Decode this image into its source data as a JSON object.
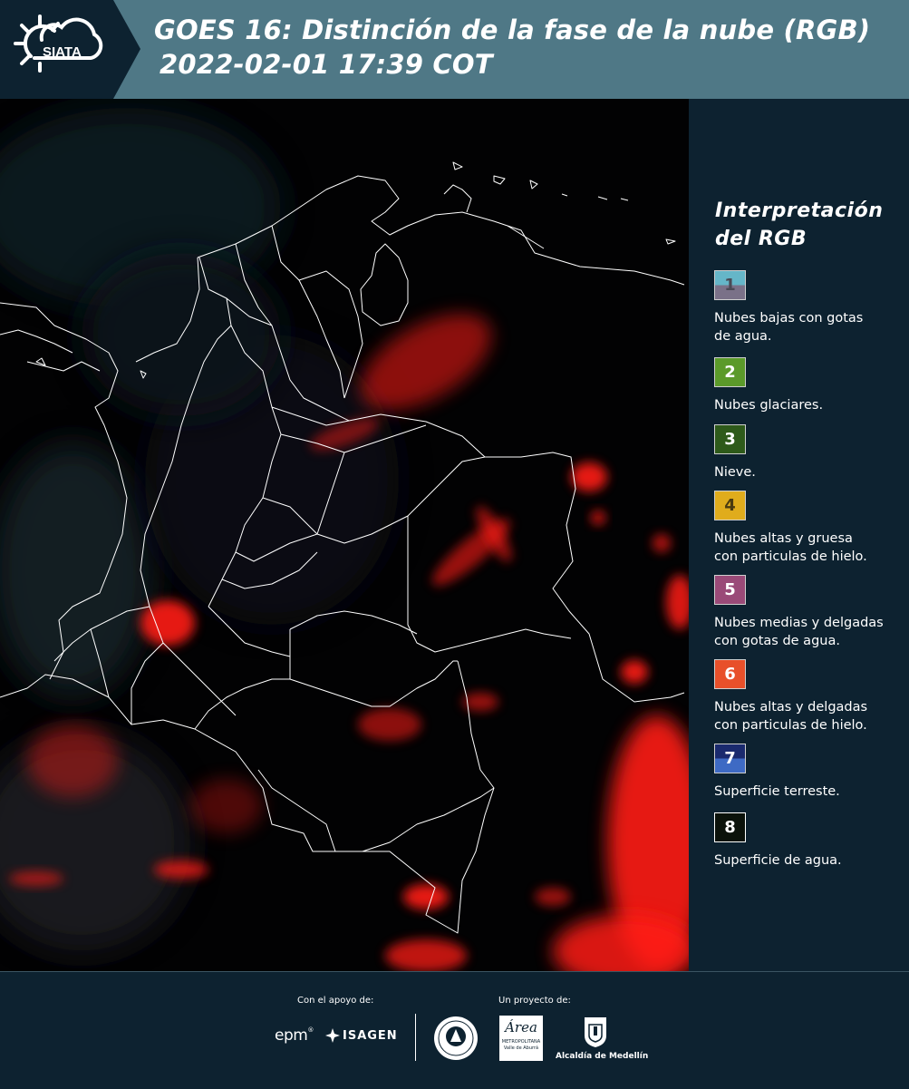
{
  "header": {
    "logo_text": "SIATA",
    "title_line1": "GOES 16: Distinción de la fase de la nube (RGB)",
    "title_line2": "2022-02-01 17:39 COT"
  },
  "legend": {
    "title_line1": "Interpretación",
    "title_line2": "del RGB",
    "items": [
      {
        "num": "1",
        "label_line1": "Nubes bajas con gotas",
        "label_line2": "de agua.",
        "color_top": "#65b6c8",
        "color_bottom": "#7a7188",
        "num_color": "#4a4a55"
      },
      {
        "num": "2",
        "label_line1": "Nubes glaciares.",
        "label_line2": "",
        "color_top": "#5b9a2a",
        "color_bottom": "#5b9a2a",
        "num_color": "#ffffff"
      },
      {
        "num": "3",
        "label_line1": "Nieve.",
        "label_line2": "",
        "color_top": "#2e5a1a",
        "color_bottom": "#2e5a1a",
        "num_color": "#ffffff"
      },
      {
        "num": "4",
        "label_line1": "Nubes altas y gruesa",
        "label_line2": "con particulas de hielo.",
        "color_top": "#e0ac1c",
        "color_bottom": "#e0ac1c",
        "num_color": "#4a3a10"
      },
      {
        "num": "5",
        "label_line1": "Nubes medias y delgadas",
        "label_line2": "con gotas de agua.",
        "color_top": "#9a4a78",
        "color_bottom": "#9a4a78",
        "num_color": "#ffffff"
      },
      {
        "num": "6",
        "label_line1": "Nubes altas y delgadas",
        "label_line2": "con particulas de hielo.",
        "color_top": "#e8502a",
        "color_bottom": "#e8502a",
        "num_color": "#ffffff"
      },
      {
        "num": "7",
        "label_line1": "Superficie terreste.",
        "label_line2": "",
        "color_top": "#1a2a6e",
        "color_bottom": "#3e6ac4",
        "num_color": "#ffffff"
      },
      {
        "num": "8",
        "label_line1": "Superficie de agua.",
        "label_line2": "",
        "color_top": "#0b120a",
        "color_bottom": "#0b120a",
        "num_color": "#ffffff"
      }
    ]
  },
  "footer": {
    "support_label": "Con el apoyo de:",
    "project_label": "Un proyecto de:",
    "brand_epm": "epm",
    "brand_isagen": "ISAGEN",
    "brand_area_line1": "Área",
    "brand_area_line2": "METROPOLITANA",
    "brand_area_line3": "Valle de Aburrá",
    "brand_alcaldia": "Alcaldía de Medellín"
  },
  "colors": {
    "background": "#0d2230",
    "header_band": "#4f7886",
    "cloud_red": "#ff1a14",
    "boundary": "#ffffff"
  }
}
